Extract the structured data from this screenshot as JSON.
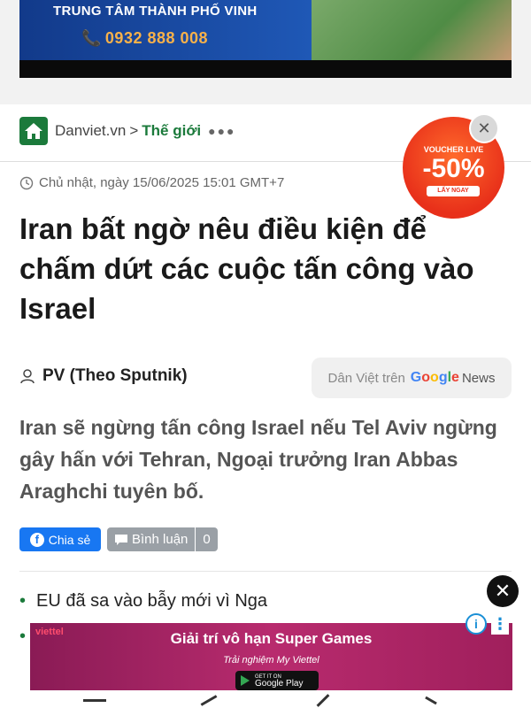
{
  "top_banner": {
    "title": "TRUNG TÂM THÀNH PHỐ VINH",
    "phone": "0932 888 008"
  },
  "breadcrumb": {
    "site": "Danviet.vn",
    "separator": ">",
    "section": "Thế giới",
    "more": "●●●"
  },
  "article": {
    "date": "Chủ nhật, ngày 15/06/2025 15:01 GMT+7",
    "title": "Iran bất ngờ nêu điều kiện để chấm dứt các cuộc tấn công vào Israel",
    "author": "PV (Theo Sputnik)",
    "sapo": "Iran sẽ ngừng tấn công Israel nếu Tel Aviv ngừng gây hấn với Tehran, Ngoại trưởng Iran Abbas Araghchi tuyên bố."
  },
  "google_news": {
    "prefix": "Dân Việt trên",
    "g": "G",
    "o1": "o",
    "o2": "o",
    "g2": "g",
    "l": "l",
    "e": "e",
    "news": "News"
  },
  "actions": {
    "share_label": "Chia sẻ",
    "comment_label": "Bình luận",
    "comment_count": "0"
  },
  "related": [
    {
      "text": "EU đã sa vào bẫy mới vì Nga"
    }
  ],
  "ad": {
    "brand": "viettel",
    "headline": "Giải trí vô hạn Super Games",
    "subline": "Trải nghiệm My Viettel",
    "store_small": "GET IT ON",
    "store_big": "Google Play",
    "info": "i",
    "menu": "⋮",
    "close": "✕"
  },
  "voucher": {
    "line1": "VOUCHER LIVE",
    "discount": "-50%",
    "cta": "LẤY NGAY",
    "close": "✕"
  },
  "colors": {
    "brand_green": "#1b7a3b",
    "facebook_blue": "#1877f2",
    "comment_gray": "#9aa0a6"
  }
}
